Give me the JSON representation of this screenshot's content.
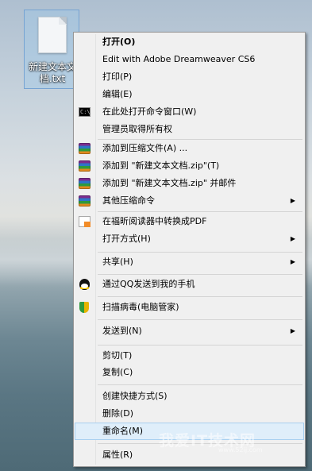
{
  "desktop": {
    "icon_label": "新建文本文档.txt"
  },
  "context_menu": {
    "items": [
      {
        "label": "打开(O)"
      },
      {
        "label": "Edit with Adobe Dreamweaver CS6"
      },
      {
        "label": "打印(P)"
      },
      {
        "label": "编辑(E)"
      },
      {
        "label": "在此处打开命令窗口(W)"
      },
      {
        "label": "管理员取得所有权"
      },
      {
        "label": "添加到压缩文件(A) ..."
      },
      {
        "label": "添加到 \"新建文本文档.zip\"(T)"
      },
      {
        "label": "添加到 \"新建文本文档.zip\" 并邮件"
      },
      {
        "label": "其他压缩命令"
      },
      {
        "label": "在福昕阅读器中转换成PDF"
      },
      {
        "label": "打开方式(H)"
      },
      {
        "label": "共享(H)"
      },
      {
        "label": "通过QQ发送到我的手机"
      },
      {
        "label": "扫描病毒(电脑管家)"
      },
      {
        "label": "发送到(N)"
      },
      {
        "label": "剪切(T)"
      },
      {
        "label": "复制(C)"
      },
      {
        "label": "创建快捷方式(S)"
      },
      {
        "label": "删除(D)"
      },
      {
        "label": "重命名(M)"
      },
      {
        "label": "属性(R)"
      }
    ],
    "submenu_arrow": "▶",
    "highlight_color": "#dfeefa"
  },
  "watermark": {
    "text": "我爱IT技术网",
    "url": "www.52ij.com"
  }
}
